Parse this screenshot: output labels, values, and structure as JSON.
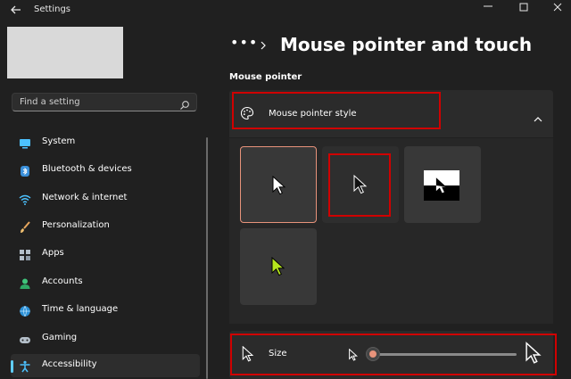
{
  "window": {
    "title": "Settings"
  },
  "search": {
    "placeholder": "Find a setting"
  },
  "sidebar": {
    "items": [
      {
        "label": "System",
        "icon": "system-icon",
        "active": false
      },
      {
        "label": "Bluetooth & devices",
        "icon": "bluetooth-icon",
        "active": false
      },
      {
        "label": "Network & internet",
        "icon": "wifi-icon",
        "active": false
      },
      {
        "label": "Personalization",
        "icon": "brush-icon",
        "active": false
      },
      {
        "label": "Apps",
        "icon": "apps-icon",
        "active": false
      },
      {
        "label": "Accounts",
        "icon": "person-icon",
        "active": false
      },
      {
        "label": "Time & language",
        "icon": "globe-icon",
        "active": false
      },
      {
        "label": "Gaming",
        "icon": "gamepad-icon",
        "active": false
      },
      {
        "label": "Accessibility",
        "icon": "accessibility-icon",
        "active": true
      }
    ]
  },
  "header": {
    "breadcrumb_more": "•••",
    "title": "Mouse pointer and touch"
  },
  "section": {
    "title": "Mouse pointer",
    "pointer_style": {
      "label": "Mouse pointer style",
      "options": [
        {
          "name": "white",
          "selected": true
        },
        {
          "name": "black",
          "selected": false
        },
        {
          "name": "inverted",
          "selected": false
        },
        {
          "name": "custom",
          "selected": false
        }
      ],
      "custom_color": "#b5e61d"
    },
    "size": {
      "label": "Size",
      "value_fraction": 0.04
    }
  },
  "colors": {
    "accent": "#e8937b",
    "highlight": "#d00000",
    "nav_indicator": "#60cdff"
  }
}
